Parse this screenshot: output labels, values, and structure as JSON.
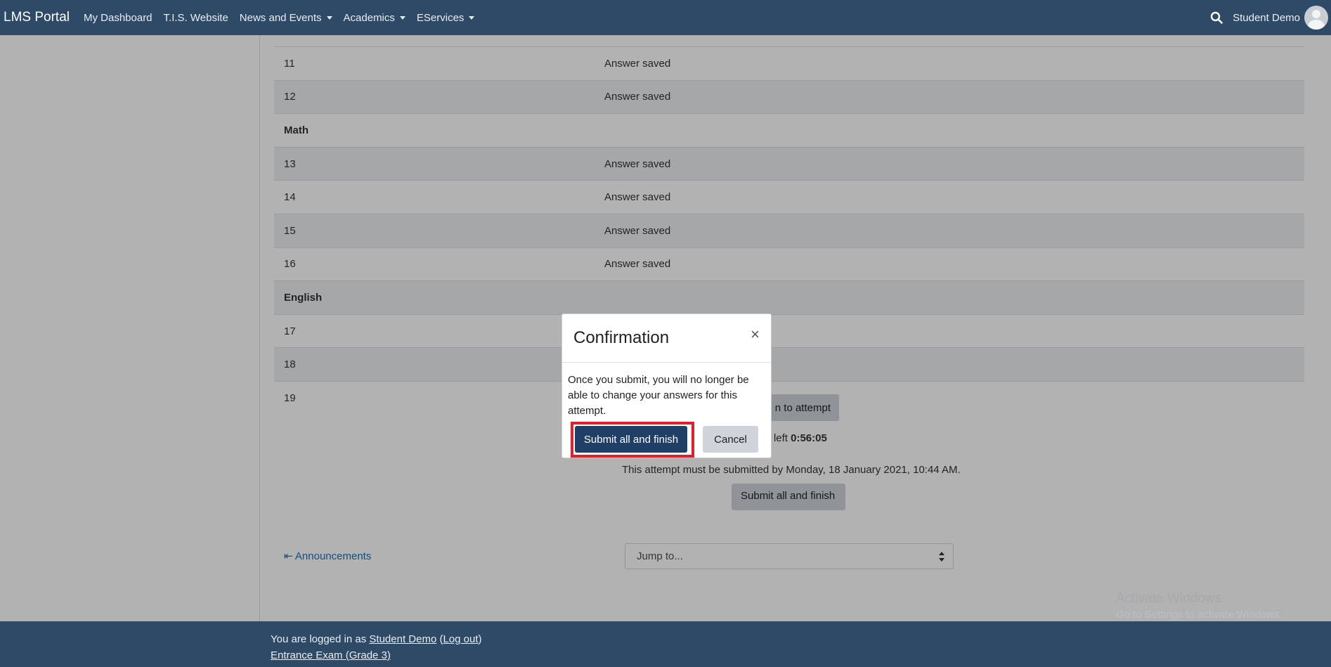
{
  "navbar": {
    "brand": "LMS Portal",
    "links": [
      {
        "label": "My Dashboard",
        "dropdown": false
      },
      {
        "label": "T.I.S. Website",
        "dropdown": false
      },
      {
        "label": "News and Events",
        "dropdown": true
      },
      {
        "label": "Academics",
        "dropdown": true
      },
      {
        "label": "EServices",
        "dropdown": true
      }
    ],
    "user_name": "Student Demo",
    "search_icon": "search-icon"
  },
  "summary": {
    "rows": [
      {
        "type": "question",
        "num": "11",
        "status": "Answer saved"
      },
      {
        "type": "question",
        "num": "12",
        "status": "Answer saved"
      },
      {
        "type": "section",
        "label": "Math"
      },
      {
        "type": "question",
        "num": "13",
        "status": "Answer saved"
      },
      {
        "type": "question",
        "num": "14",
        "status": "Answer saved"
      },
      {
        "type": "question",
        "num": "15",
        "status": "Answer saved"
      },
      {
        "type": "question",
        "num": "16",
        "status": "Answer saved"
      },
      {
        "type": "section",
        "label": "English"
      },
      {
        "type": "question",
        "num": "17",
        "status": ""
      },
      {
        "type": "question",
        "num": "18",
        "status": ""
      },
      {
        "type": "question",
        "num": "19",
        "status": ""
      }
    ]
  },
  "attempt": {
    "return_label_visible": "n to attempt",
    "time_left_label": "Time left",
    "time_left_value": "0:56:05",
    "deadline_text": "This attempt must be submitted by Monday, 18 January 2021, 10:44 AM.",
    "submit_label": "Submit all and finish"
  },
  "footer_nav": {
    "announcements_label": "Announcements",
    "jump_placeholder": "Jump to..."
  },
  "footer": {
    "logged_in_prefix": "You are logged in as",
    "user_link": "Student Demo",
    "logout_label": "Log out",
    "course_link": "Entrance Exam (Grade 3)"
  },
  "watermark": {
    "title": "Activate Windows",
    "subtitle": "Go to Settings to activate Windows."
  },
  "modal": {
    "title": "Confirmation",
    "close_symbol": "×",
    "body": "Once you submit, you will no longer be able to change your answers for this attempt.",
    "primary_label": "Submit all and finish",
    "cancel_label": "Cancel",
    "highlight_color": "#e0202c"
  }
}
